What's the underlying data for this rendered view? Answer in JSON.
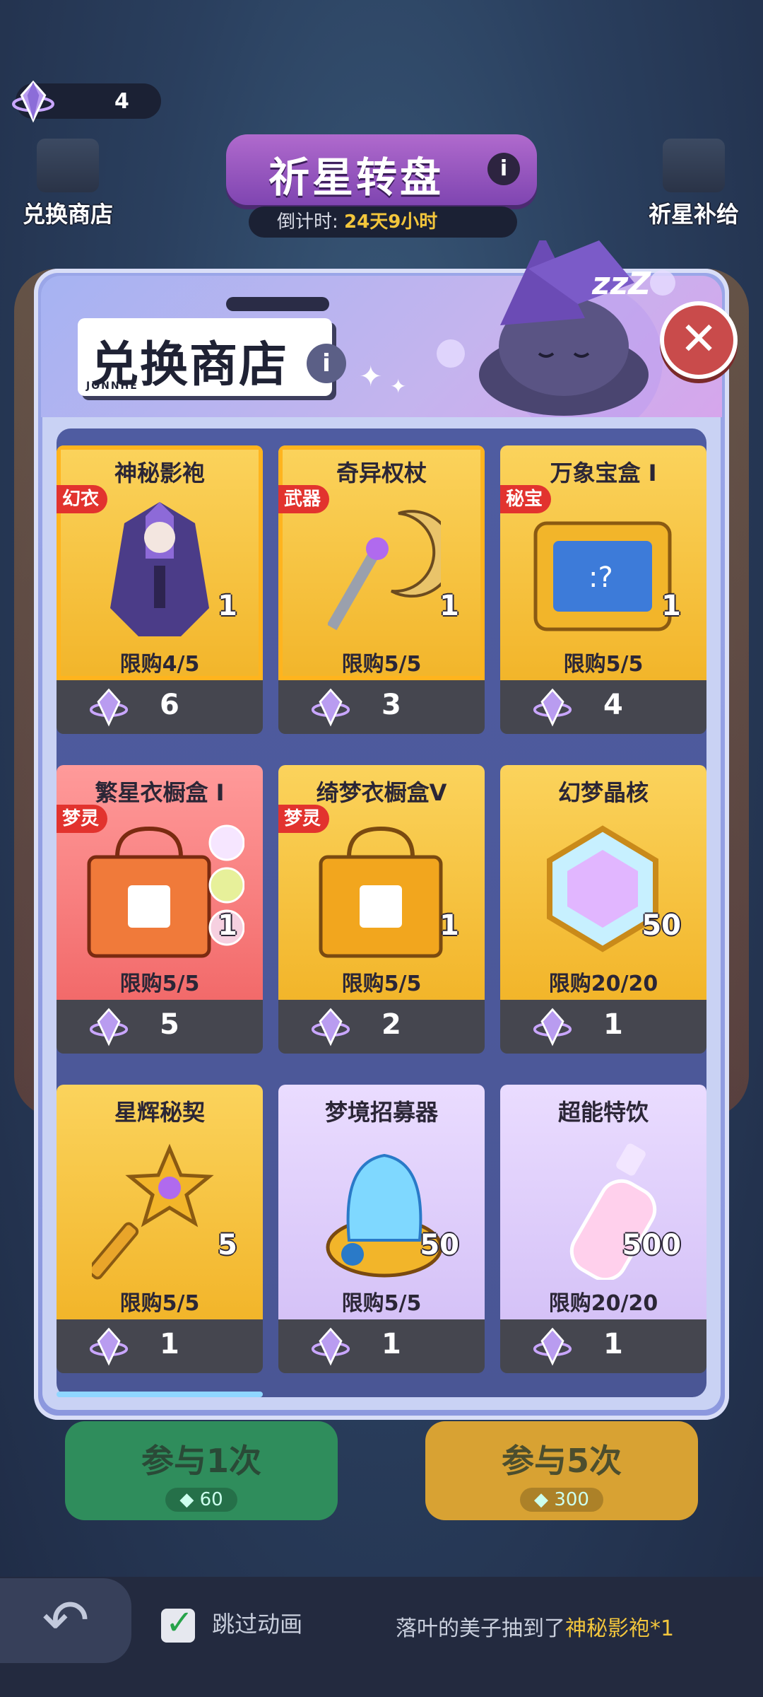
{
  "top": {
    "currency_value": "4",
    "left_button_label": "兑换商店",
    "right_button_label": "祈星补给",
    "title": "祈星转盘",
    "info_glyph": "i",
    "countdown_prefix": "倒计时:",
    "countdown_value": "24天9小时"
  },
  "modal": {
    "title": "兑换商店",
    "logo_text": "JONNHE",
    "info_glyph": "i",
    "close_glyph": "✕",
    "sleep_text": "zzZ"
  },
  "items": [
    {
      "name": "神秘影袍",
      "tag": "幻衣",
      "qty": "1",
      "limit": "限购4/5",
      "price": "6",
      "style": "gold"
    },
    {
      "name": "奇异权杖",
      "tag": "武器",
      "qty": "1",
      "limit": "限购5/5",
      "price": "3",
      "style": "gold"
    },
    {
      "name": "万象宝盒 I",
      "tag": "秘宝",
      "qty": "1",
      "limit": "限购5/5",
      "price": "4",
      "style": "gold"
    },
    {
      "name": "繁星衣橱盒 I",
      "tag": "梦灵",
      "qty": "1",
      "limit": "限购5/5",
      "price": "5",
      "style": "pink"
    },
    {
      "name": "绮梦衣橱盒V",
      "tag": "梦灵",
      "qty": "1",
      "limit": "限购5/5",
      "price": "2",
      "style": "gold"
    },
    {
      "name": "幻梦晶核",
      "tag": "",
      "qty": "50",
      "limit": "限购20/20",
      "price": "1",
      "style": "gold"
    },
    {
      "name": "星辉秘契",
      "tag": "",
      "qty": "5",
      "limit": "限购5/5",
      "price": "1",
      "style": "gold"
    },
    {
      "name": "梦境招募器",
      "tag": "",
      "qty": "50",
      "limit": "限购5/5",
      "price": "1",
      "style": "purple"
    },
    {
      "name": "超能特饮",
      "tag": "",
      "qty": "500",
      "limit": "限购20/20",
      "price": "1",
      "style": "purple"
    }
  ],
  "bottom": {
    "join_once_label": "参与1次",
    "join_once_cost": "60",
    "join_five_label": "参与5次",
    "join_five_cost": "300",
    "skip_label": "跳过动画",
    "ticker_prefix": "落叶的美子抽到了",
    "ticker_item": "神秘影袍",
    "ticker_suffix": "*1"
  },
  "colors": {
    "accent_gold": "#f3c63c",
    "tag_red": "#e2332e",
    "panel_blue": "#4f5ca1",
    "close_red": "#c94b4b"
  }
}
